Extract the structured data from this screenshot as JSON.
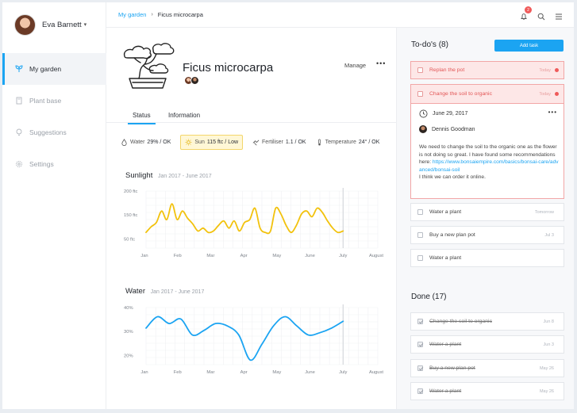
{
  "user": {
    "name": "Eva Barnett"
  },
  "sidebar": {
    "items": [
      {
        "label": "My garden",
        "icon": "plant-icon",
        "active": true
      },
      {
        "label": "Plant base",
        "icon": "book-icon",
        "active": false
      },
      {
        "label": "Suggestions",
        "icon": "lightbulb-icon",
        "active": false
      },
      {
        "label": "Settings",
        "icon": "gear-icon",
        "active": false
      }
    ]
  },
  "header": {
    "breadcrumb": {
      "parent": "My garden",
      "current": "Ficus microcarpa"
    },
    "notifications": "2"
  },
  "plant": {
    "name": "Ficus microcarpa",
    "manage_label": "Manage",
    "more": "•••",
    "tabs": [
      "Status",
      "Information"
    ],
    "stats": [
      {
        "label": "Water",
        "value": "29% / OK",
        "icon": "droplet-icon"
      },
      {
        "label": "Sun",
        "value": "115 ftc / Low",
        "icon": "sun-icon"
      },
      {
        "label": "Fertiliser",
        "value": "1.1 / OK",
        "icon": "fertiliser-icon"
      },
      {
        "label": "Temperature",
        "value": "24° / OK",
        "icon": "thermometer-icon"
      }
    ]
  },
  "chart_data": [
    {
      "type": "line",
      "title": "Sunlight",
      "subtitle": "Jan 2017 - June 2017",
      "x_ticks": [
        "Jan",
        "Feb",
        "Mar",
        "Apr",
        "May",
        "June",
        "July",
        "August"
      ],
      "y_ticks": [
        "200 ftc",
        "150 ftc",
        "50 ftc"
      ],
      "ylim": [
        0,
        200
      ],
      "color": "#f2c20d",
      "series": [
        {
          "values": [
            55,
            75,
            90,
            130,
            100,
            155,
            100,
            130,
            105,
            85,
            60,
            70,
            55,
            60,
            80,
            95,
            70,
            95,
            60,
            90,
            100,
            140,
            70,
            55,
            60,
            140,
            120,
            80,
            55,
            80,
            120,
            130,
            110,
            140,
            125,
            95,
            70,
            55,
            60
          ]
        }
      ]
    },
    {
      "type": "line",
      "title": "Water",
      "subtitle": "Jan 2017 - June 2017",
      "x_ticks": [
        "Jan",
        "Feb",
        "Mar",
        "Apr",
        "May",
        "June",
        "July",
        "August"
      ],
      "y_ticks": [
        "40%",
        "30%",
        "20%"
      ],
      "ylim": [
        15,
        40
      ],
      "color": "#1ba4f2",
      "series": [
        {
          "values": [
            31,
            36,
            33,
            35,
            28,
            30,
            33,
            32,
            28,
            17,
            24,
            32,
            36,
            32,
            28,
            29,
            31,
            34
          ]
        }
      ]
    }
  ],
  "todo": {
    "title": "To-do's (8)",
    "add_label": "Add task",
    "tasks": [
      {
        "label": "Replan the pot",
        "date": "Today",
        "alert": true
      },
      {
        "label": "Change the soil to organic",
        "date": "Today",
        "alert": true
      },
      {
        "label": "Water a plant",
        "date": "Tomorrow",
        "alert": false
      },
      {
        "label": "Buy a new plan pot",
        "date": "Jul 3",
        "alert": false
      },
      {
        "label": "Water a plant",
        "date": "",
        "alert": false
      }
    ],
    "detail": {
      "date": "June 29, 2017",
      "author": "Dennis Goodman",
      "text_before": "We need to change the soil to the organic one as the flower is not doing so great. I have found some recommendations here: ",
      "link": "https://www.bonsaiempire.com/basics/bonsai-care/advanced/bonsai-soil",
      "text_after": "I think we can order it online."
    }
  },
  "done": {
    "title": "Done (17)",
    "tasks": [
      {
        "label": "Change the soil to organic",
        "date": "Jun 8"
      },
      {
        "label": "Water a plant",
        "date": "Jun 3"
      },
      {
        "label": "Buy a new plan pot",
        "date": "May 26"
      },
      {
        "label": "Water a plant",
        "date": "May 26"
      }
    ]
  }
}
